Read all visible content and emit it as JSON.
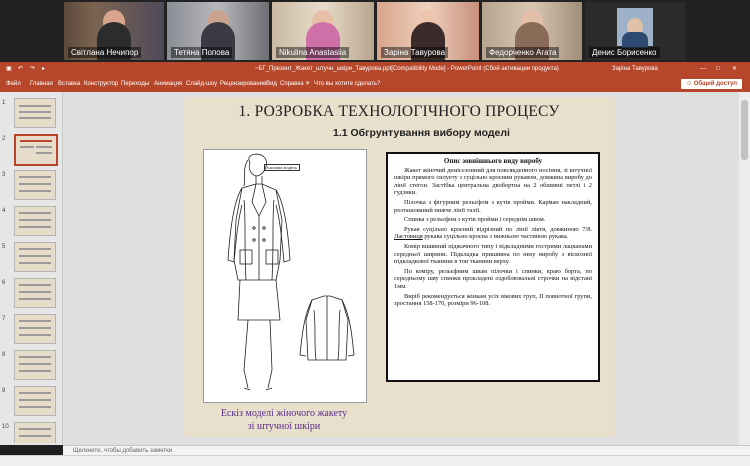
{
  "participants": [
    {
      "name": "Світлана Нечипор"
    },
    {
      "name": "Тетяна Попова"
    },
    {
      "name": "Nikulina Anastasiia"
    },
    {
      "name": "Заріна Тавурова"
    },
    {
      "name": "Федорченко Агата"
    },
    {
      "name": "Денис Борисенко"
    }
  ],
  "titlebar": {
    "document": "~БГ_Презент_Жакет_штучн_шкіри_Тавурова.ppt[Compatibility Mode] - PowerPoint (Сбой активации продукта)",
    "user": "Заріна Тавурова"
  },
  "ribbon": {
    "tabs": [
      "Файл",
      "Главная",
      "Вставка",
      "Конструктор",
      "Переходы",
      "Анимация",
      "Слайд-шоу",
      "Рецензирование",
      "Вид",
      "Справка"
    ],
    "search": "Что вы хотите сделать?",
    "share": "Общий доступ"
  },
  "thumbnails": [
    "1",
    "2",
    "3",
    "4",
    "5",
    "6",
    "7",
    "8",
    "9",
    "10"
  ],
  "slide": {
    "title": "1. РОЗРОБКА ТЕХНОЛОГІЧНОГО ПРОЦЕСУ",
    "subtitle": "1.1  Обгрунтування вибору моделі",
    "sketch_label": "Базоваа модель",
    "caption_line1": "Ескіз моделі жіночого жакету",
    "caption_line2": "зі штучної шкіри",
    "desc_heading": "Опис зовнішнього виду виробу",
    "desc_p1": "Жакет жіночий демісезонний для повсякденного носіння, зі штучної шкіри прямого силуету з суцільно кроєним рукавом, довжина виробу до лінії стегон. Застібка центральна двобортна на 2 обшивні петлі і 2 гудзики.",
    "desc_p2": "Пілочка з фігурним рельєфом з кутів пройми. Карман накладний, розташований нижче лінії талії.",
    "desc_p3": "Спинка з рельєфом з кутів пройми і середнім швом.",
    "desc_p4a": "Рукав суцільно кроєний відрізний по лінії ліктя, довжиною 7/8. ",
    "desc_p4u": "Ластовиця",
    "desc_p4b": " рукава суцільно кроєна з нижньою частиною рукава.",
    "desc_p5": "Комір вшивний піджачного типу і відкладними гострими лацканами середньої ширини. Підкладка пришивна по низу виробу з віскозної підкладкової тканини в тон тканини верху.",
    "desc_p6": "По коміру, рельєфним швам пілочки і спинки, краю борта, по середньому шву спинки прокладені оздоблювальні строчки на відстані 1мм.",
    "desc_p7": "Виріб рекомендується жінкам усіх вікових груп, II повнотної групи, зростання 158-170, розміри 96-108."
  },
  "notes": "Щелкните, чтобы добавить заметки"
}
